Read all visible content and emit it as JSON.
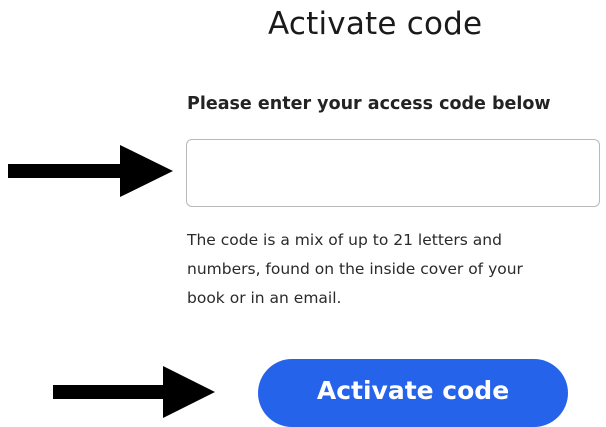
{
  "page": {
    "title": "Activate code"
  },
  "form": {
    "label": "Please enter your access code below",
    "input_value": "",
    "input_placeholder": "",
    "help_text": "The code is a mix of up to 21 letters and\nnumbers, found on the inside cover of your\nbook or in an email.",
    "submit_label": "Activate code"
  },
  "icons": {
    "arrow_to_input": "right-arrow-icon",
    "arrow_to_button": "right-arrow-icon"
  },
  "colors": {
    "button_background": "#2563eb",
    "button_text": "#ffffff",
    "input_border": "#b9b9b9",
    "arrow": "#000000"
  }
}
